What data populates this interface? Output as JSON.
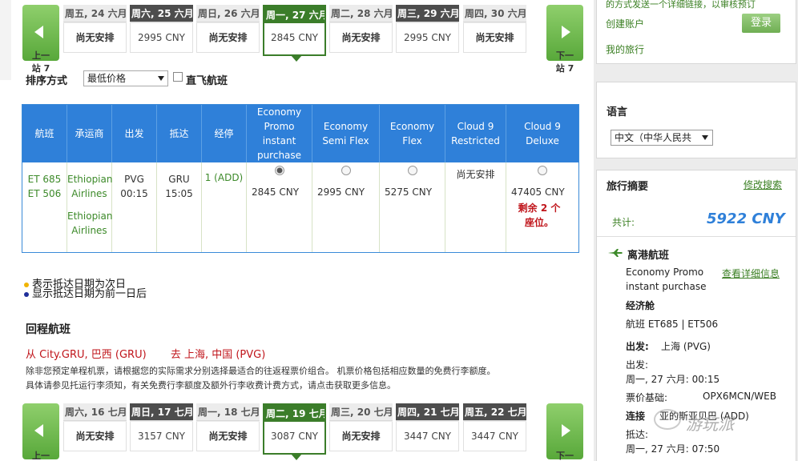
{
  "outbound_dates": {
    "prev_label_top": "上一",
    "prev_label_bottom": "站 7",
    "next_label_top": "下一",
    "next_label_bottom": "站 7",
    "days": [
      {
        "date": "周五, 24 六月",
        "price": "尚无安排"
      },
      {
        "date": "周六, 25 六月",
        "price": "2995 CNY"
      },
      {
        "date": "周日, 26 六月",
        "price": "尚无安排"
      },
      {
        "date": "周一, 27 六月",
        "price": "2845 CNY"
      },
      {
        "date": "周二, 28 六月",
        "price": "尚无安排"
      },
      {
        "date": "周三, 29 六月",
        "price": "2995 CNY"
      },
      {
        "date": "周四, 30 六月",
        "price": "尚无安排"
      }
    ]
  },
  "sort": {
    "label": "排序方式",
    "selected": "最低价格",
    "direct_label": "直飞航班"
  },
  "flight_table": {
    "headers": [
      "航班",
      "承运商",
      "出发",
      "抵达",
      "经停",
      "Economy Promo instant purchase",
      "Economy Semi Flex",
      "Economy Flex",
      "Cloud 9 Restricted",
      "Cloud 9 Deluxe"
    ],
    "row": {
      "flights": [
        "ET 685",
        "ET 506"
      ],
      "carriers": [
        "Ethiopian Airlines",
        "Ethiopian Airlines"
      ],
      "depart_code": "PVG",
      "depart_time": "00:15",
      "arrive_code": "GRU",
      "arrive_time": "15:05",
      "stops": "1 (ADD)",
      "promo_price": "2845 CNY",
      "semiflex_price": "2995 CNY",
      "flex_price": "5275 CNY",
      "c9r": "尚无安排",
      "c9d_price": "47405 CNY",
      "c9d_seats_line1": "剩余 2 个",
      "c9d_seats_line2": "座位。"
    }
  },
  "legend": {
    "line1": "表示抵达日期为次日",
    "line2": "显示抵达日期为前一日后"
  },
  "return_section": {
    "title": "回程航班",
    "from": "从 City.GRU, 巴西 (GRU)",
    "to": "去 上海, 中国 (PVG)",
    "note_line1": "除非您预定单程机票，请根据您的实际需求分别选择最适合的往返程票价组合。 机票价格包括相应数量的免费行李额度。",
    "note_line2": "具体请参见托运行李须知，有关免费行李额度及额外行李收费计费方式，请点击获取更多信息。"
  },
  "return_dates": {
    "prev_label": "上一",
    "next_label": "下一",
    "days": [
      {
        "date": "周六, 16 七月",
        "price": "尚无安排"
      },
      {
        "date": "周日, 17 七月",
        "price": "3157 CNY"
      },
      {
        "date": "周一, 18 七月",
        "price": "尚无安排"
      },
      {
        "date": "周二, 19 七月",
        "price": "3087 CNY"
      },
      {
        "date": "周三, 20 七月",
        "price": "尚无安排"
      },
      {
        "date": "周四, 21 七月",
        "price": "3447 CNY"
      },
      {
        "date": "周五, 22 七月",
        "price": "3447 CNY"
      }
    ]
  },
  "account": {
    "top_text": "的方式发送一个详细链接，以审核预订",
    "create_account": "创建账户",
    "my_trips": "我的旅行",
    "login": "登录"
  },
  "language": {
    "title": "语言",
    "selected": "中文（中华人民共"
  },
  "summary": {
    "title": "旅行摘要",
    "modify": "修改搜索",
    "total_label": "共计:",
    "total_value": "5922 CNY",
    "depart_title": "离港航班",
    "fare_name": "Economy Promo instant purchase",
    "details_link": "查看详细信息",
    "cabin": "经济舱",
    "flights": "航班 ET685 | ET506",
    "from_label": "出发:",
    "from_value": "上海 (PVG)",
    "depart_label": "出发:",
    "depart_value": "周一, 27 六月: 00:15",
    "fare_basis_label": "票价基础:",
    "fare_basis_value": "OPX6MCN/WEB",
    "connect_label": "连接",
    "connect_value": "亚的斯亚贝巴 (ADD)",
    "arrive_label": "抵达:",
    "arrive_value": "周一, 27 六月: 07:50"
  },
  "watermark": "游玩派",
  "colors": {
    "accent_green": "#3b7d2a",
    "table_blue": "#2f80d9",
    "price_red": "#c0151b"
  }
}
